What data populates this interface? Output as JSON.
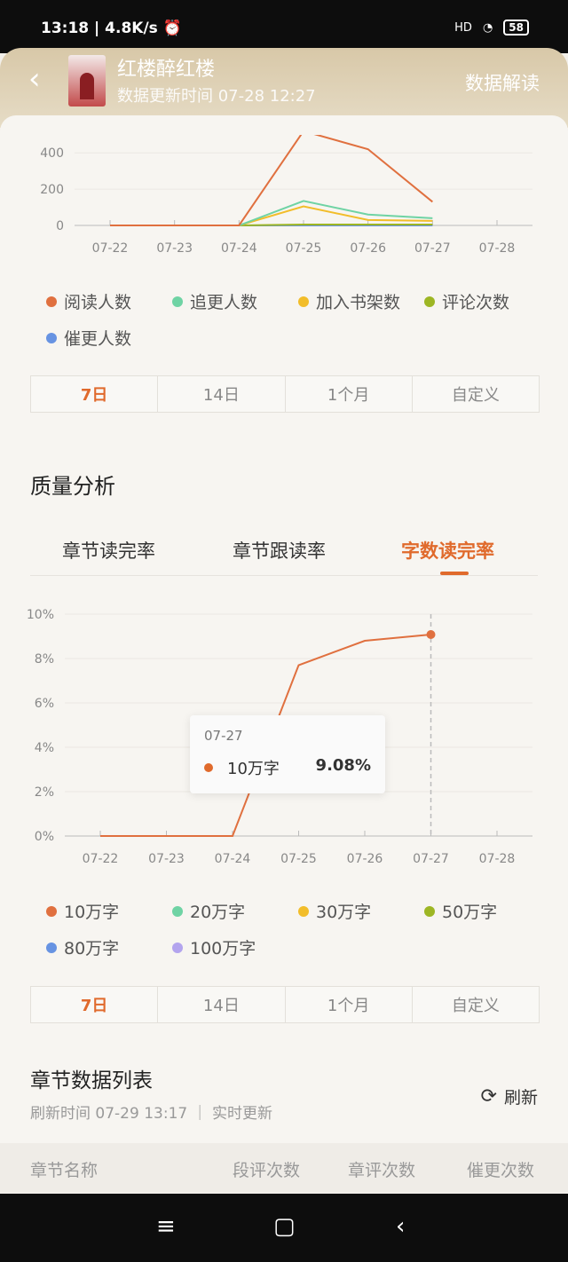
{
  "status": {
    "time": "13:18",
    "speed": "4.8K/s",
    "signal": "HD",
    "battery": "58"
  },
  "header": {
    "title": "红楼醉红楼",
    "updated": "数据更新时间 07-28 12:27",
    "action": "数据解读"
  },
  "chart1": {
    "legend": [
      "阅读人数",
      "追更人数",
      "加入书架数",
      "评论次数",
      "催更人数"
    ],
    "colors": [
      "#e0703f",
      "#6fd3a4",
      "#f2bd2a",
      "#9db624",
      "#6793e2"
    ]
  },
  "range_tabs": [
    "7日",
    "14日",
    "1个月",
    "自定义"
  ],
  "quality": {
    "title": "质量分析",
    "tabs": [
      "章节读完率",
      "章节跟读率",
      "字数读完率"
    ],
    "tooltip": {
      "date": "07-27",
      "name": "10万字",
      "value": "9.08%"
    },
    "legend": [
      "10万字",
      "20万字",
      "30万字",
      "50万字",
      "80万字",
      "100万字"
    ],
    "colors": [
      "#e0703f",
      "#6fd3a4",
      "#f2bd2a",
      "#9db624",
      "#6793e2",
      "#b3a4ee"
    ]
  },
  "list": {
    "title": "章节数据列表",
    "sub": "刷新时间 07-29 13:17 ｜ 实时更新",
    "refresh": "刷新",
    "columns": [
      "章节名称",
      "段评次数",
      "章评次数",
      "催更次数"
    ]
  },
  "chart_data": [
    {
      "type": "line",
      "x": [
        "07-22",
        "07-23",
        "07-24",
        "07-25",
        "07-26",
        "07-27",
        "07-28"
      ],
      "ylim": [
        0,
        450
      ],
      "yticks": [
        "0",
        "200",
        "400"
      ],
      "grid": true,
      "legend_position": "bottom",
      "series": [
        {
          "name": "阅读人数",
          "values": [
            0,
            0,
            0,
            520,
            420,
            130,
            null
          ]
        },
        {
          "name": "追更人数",
          "values": [
            0,
            0,
            0,
            135,
            60,
            40,
            null
          ]
        },
        {
          "name": "加入书架数",
          "values": [
            0,
            0,
            0,
            105,
            30,
            25,
            null
          ]
        },
        {
          "name": "评论次数",
          "values": [
            0,
            0,
            0,
            5,
            5,
            5,
            null
          ]
        },
        {
          "name": "催更人数",
          "values": [
            0,
            0,
            0,
            0,
            0,
            0,
            null
          ]
        }
      ]
    },
    {
      "type": "line",
      "x": [
        "07-22",
        "07-23",
        "07-24",
        "07-25",
        "07-26",
        "07-27",
        "07-28"
      ],
      "ylim": [
        0,
        10
      ],
      "yticks": [
        "0%",
        "2%",
        "4%",
        "6%",
        "8%",
        "10%"
      ],
      "grid": true,
      "legend_position": "bottom",
      "series": [
        {
          "name": "10万字",
          "values": [
            0,
            0,
            0,
            7.7,
            8.8,
            9.08,
            null
          ]
        }
      ]
    }
  ]
}
